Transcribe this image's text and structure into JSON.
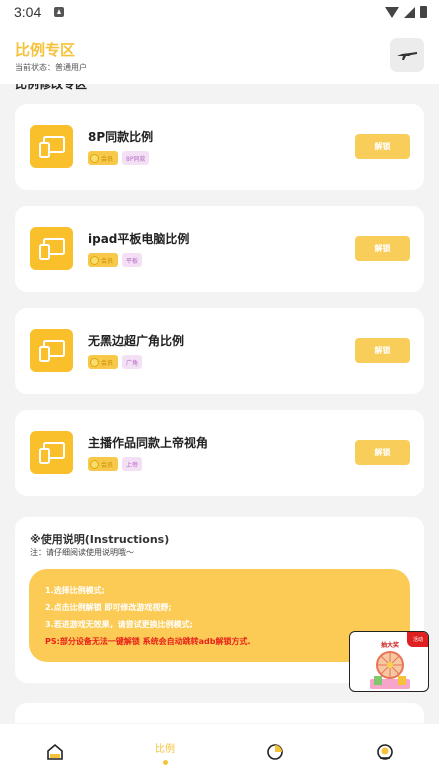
{
  "status_bar": {
    "time": "3:04"
  },
  "header": {
    "title": "比例专区",
    "current_status": "当前状态：普通用户"
  },
  "section_title": "比例修改专区",
  "cards": [
    {
      "name": "8P同款比例",
      "badge_gold": "会员",
      "badge_tag": "8P同款",
      "unlock": "解锁"
    },
    {
      "name": "ipad平板电脑比例",
      "badge_gold": "会员",
      "badge_tag": "平板",
      "unlock": "解锁"
    },
    {
      "name": "无黑边超广角比例",
      "badge_gold": "会员",
      "badge_tag": "广角",
      "unlock": "解锁"
    },
    {
      "name": "主播作品同款上帝视角",
      "badge_gold": "会员",
      "badge_tag": "上帝",
      "unlock": "解锁"
    }
  ],
  "instructions": {
    "title": "※使用说明(Instructions)",
    "note": "注：请仔细阅读使用说明哦～",
    "lines": [
      "1.选择比例模式;",
      "2.点击比例解锁 即可修改游戏视野;",
      "3.若进游戏无效果，请尝试更换比例模式;"
    ],
    "ps": "PS:部分设备无法一键解锁 系统会自动跳转adb解锁方式."
  },
  "float_ad": {
    "title": "抽大奖",
    "tag": "活动"
  },
  "bottom_nav": {
    "active_label": "比例"
  },
  "colors": {
    "accent": "#f5c23a",
    "unlock_button": "#f9cd5a",
    "ps_text": "#e8211a"
  },
  "icons": [
    "gun-icon",
    "tablet-phone-icon",
    "home-icon",
    "pie-chart-icon",
    "profile-icon"
  ]
}
